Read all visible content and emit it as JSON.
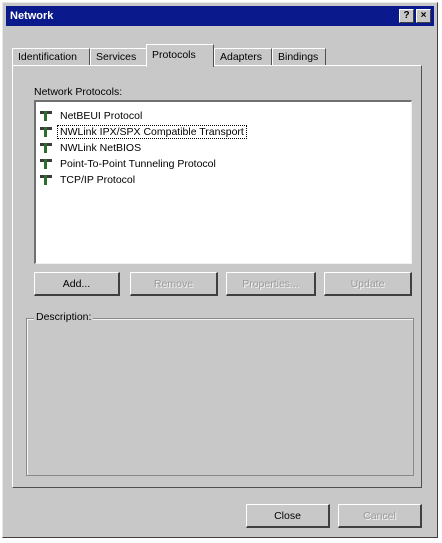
{
  "window": {
    "title": "Network",
    "help_btn": "?",
    "close_btn": "×"
  },
  "tabs": [
    {
      "label": "Identification"
    },
    {
      "label": "Services"
    },
    {
      "label": "Protocols"
    },
    {
      "label": "Adapters"
    },
    {
      "label": "Bindings"
    }
  ],
  "active_tab": "Protocols",
  "protocols": {
    "label": "Network Protocols:",
    "items": [
      {
        "name": "NetBEUI Protocol"
      },
      {
        "name": "NWLink IPX/SPX Compatible Transport",
        "selected": true
      },
      {
        "name": "NWLink NetBIOS"
      },
      {
        "name": "Point-To-Point Tunneling Protocol"
      },
      {
        "name": "TCP/IP Protocol"
      }
    ]
  },
  "buttons": {
    "add": "Add...",
    "remove": "Remove",
    "properties": "Properties...",
    "update": "Update"
  },
  "description": {
    "label": "Description:",
    "text": ""
  },
  "footer": {
    "close": "Close",
    "cancel": "Cancel"
  }
}
